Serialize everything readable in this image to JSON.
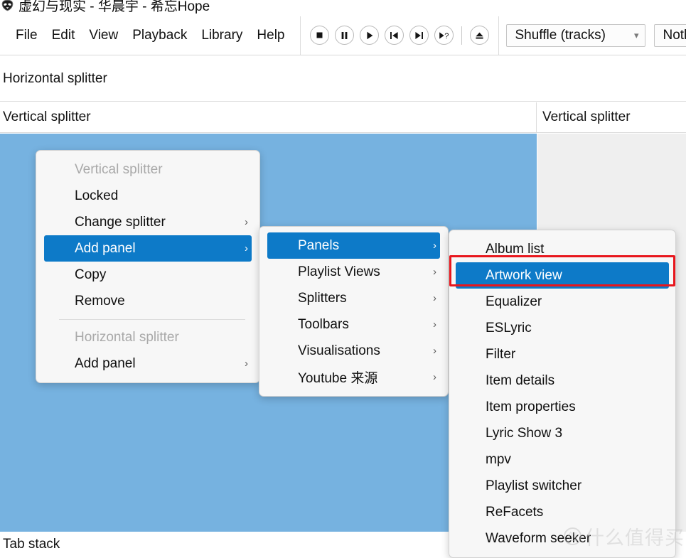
{
  "window": {
    "title": "虚幻与现实 - 华晨宇 - 希忘Hope",
    "app_icon": "alien-head-icon"
  },
  "menubar": {
    "items": [
      {
        "label": "File",
        "name": "menu-file"
      },
      {
        "label": "Edit",
        "name": "menu-edit"
      },
      {
        "label": "View",
        "name": "menu-view"
      },
      {
        "label": "Playback",
        "name": "menu-playback"
      },
      {
        "label": "Library",
        "name": "menu-library"
      },
      {
        "label": "Help",
        "name": "menu-help"
      }
    ]
  },
  "playback_controls": [
    {
      "name": "stop-button",
      "icon": "stop-icon"
    },
    {
      "name": "pause-button",
      "icon": "pause-icon"
    },
    {
      "name": "play-button",
      "icon": "play-icon"
    },
    {
      "name": "previous-button",
      "icon": "previous-track-icon"
    },
    {
      "name": "next-button",
      "icon": "next-track-icon"
    },
    {
      "name": "random-button",
      "icon": "play-random-icon"
    },
    {
      "name": "eject-button",
      "icon": "eject-icon"
    }
  ],
  "toolbar": {
    "playback_order": {
      "value": "Shuffle (tracks)",
      "chevron": "chevron-down-icon"
    },
    "output_device": {
      "value": "Nothi"
    }
  },
  "layout": {
    "horizontal_splitter_label": "Horizontal splitter",
    "vertical_splitter_label_left": "Vertical splitter",
    "vertical_splitter_label_right": "Vertical splitter",
    "tab_stack_label": "Tab stack",
    "panel_blue_color": "#76b2e0",
    "panel_gray_color": "#efefef"
  },
  "context_menu_1": {
    "name": "splitter-context-menu",
    "items": [
      {
        "label": "Vertical splitter",
        "type": "header",
        "name": "section-vertical-splitter"
      },
      {
        "label": "Locked",
        "type": "item",
        "name": "menu-locked"
      },
      {
        "label": "Change splitter",
        "type": "submenu",
        "name": "menu-change-splitter",
        "arrow": "chevron-right-icon"
      },
      {
        "label": "Add panel",
        "type": "submenu",
        "name": "menu-add-panel",
        "selected": true,
        "arrow": "chevron-right-icon"
      },
      {
        "label": "Copy",
        "type": "item",
        "name": "menu-copy"
      },
      {
        "label": "Remove",
        "type": "item",
        "name": "menu-remove"
      },
      {
        "label": "",
        "type": "separator",
        "name": "menu-separator"
      },
      {
        "label": "Horizontal splitter",
        "type": "header",
        "name": "section-horizontal-splitter"
      },
      {
        "label": "Add panel",
        "type": "submenu",
        "name": "menu-add-panel-horizontal",
        "arrow": "chevron-right-icon"
      }
    ]
  },
  "context_menu_2": {
    "name": "add-panel-submenu",
    "items": [
      {
        "label": "Panels",
        "type": "submenu",
        "name": "submenu-panels",
        "selected": true,
        "arrow": "chevron-right-icon"
      },
      {
        "label": "Playlist Views",
        "type": "submenu",
        "name": "submenu-playlist-views",
        "arrow": "chevron-right-icon"
      },
      {
        "label": "Splitters",
        "type": "submenu",
        "name": "submenu-splitters",
        "arrow": "chevron-right-icon"
      },
      {
        "label": "Toolbars",
        "type": "submenu",
        "name": "submenu-toolbars",
        "arrow": "chevron-right-icon"
      },
      {
        "label": "Visualisations",
        "type": "submenu",
        "name": "submenu-visualisations",
        "arrow": "chevron-right-icon"
      },
      {
        "label": "Youtube 来源",
        "type": "submenu",
        "name": "submenu-youtube-source",
        "arrow": "chevron-right-icon"
      }
    ]
  },
  "context_menu_3": {
    "name": "panels-submenu",
    "items": [
      {
        "label": "Album list",
        "name": "panel-album-list"
      },
      {
        "label": "Artwork view",
        "name": "panel-artwork-view",
        "selected": true,
        "highlighted": true
      },
      {
        "label": "Equalizer",
        "name": "panel-equalizer"
      },
      {
        "label": "ESLyric",
        "name": "panel-eslyric"
      },
      {
        "label": "Filter",
        "name": "panel-filter"
      },
      {
        "label": "Item details",
        "name": "panel-item-details"
      },
      {
        "label": "Item properties",
        "name": "panel-item-properties"
      },
      {
        "label": "Lyric Show 3",
        "name": "panel-lyric-show-3"
      },
      {
        "label": "mpv",
        "name": "panel-mpv"
      },
      {
        "label": "Playlist switcher",
        "name": "panel-playlist-switcher"
      },
      {
        "label": "ReFacets",
        "name": "panel-refacets"
      },
      {
        "label": "Waveform seeker",
        "name": "panel-waveform-seeker"
      }
    ]
  },
  "annotation": {
    "highlight_color": "#e8161d",
    "target_label": "Artwork view"
  },
  "watermark": {
    "text": "什么值得买",
    "logo_glyph": "值"
  },
  "colors": {
    "selection_blue": "#0d7ac8",
    "panel_blue": "#76b2e0",
    "menu_bg": "#f7f7f7",
    "disabled_text": "#a9a9a9"
  }
}
